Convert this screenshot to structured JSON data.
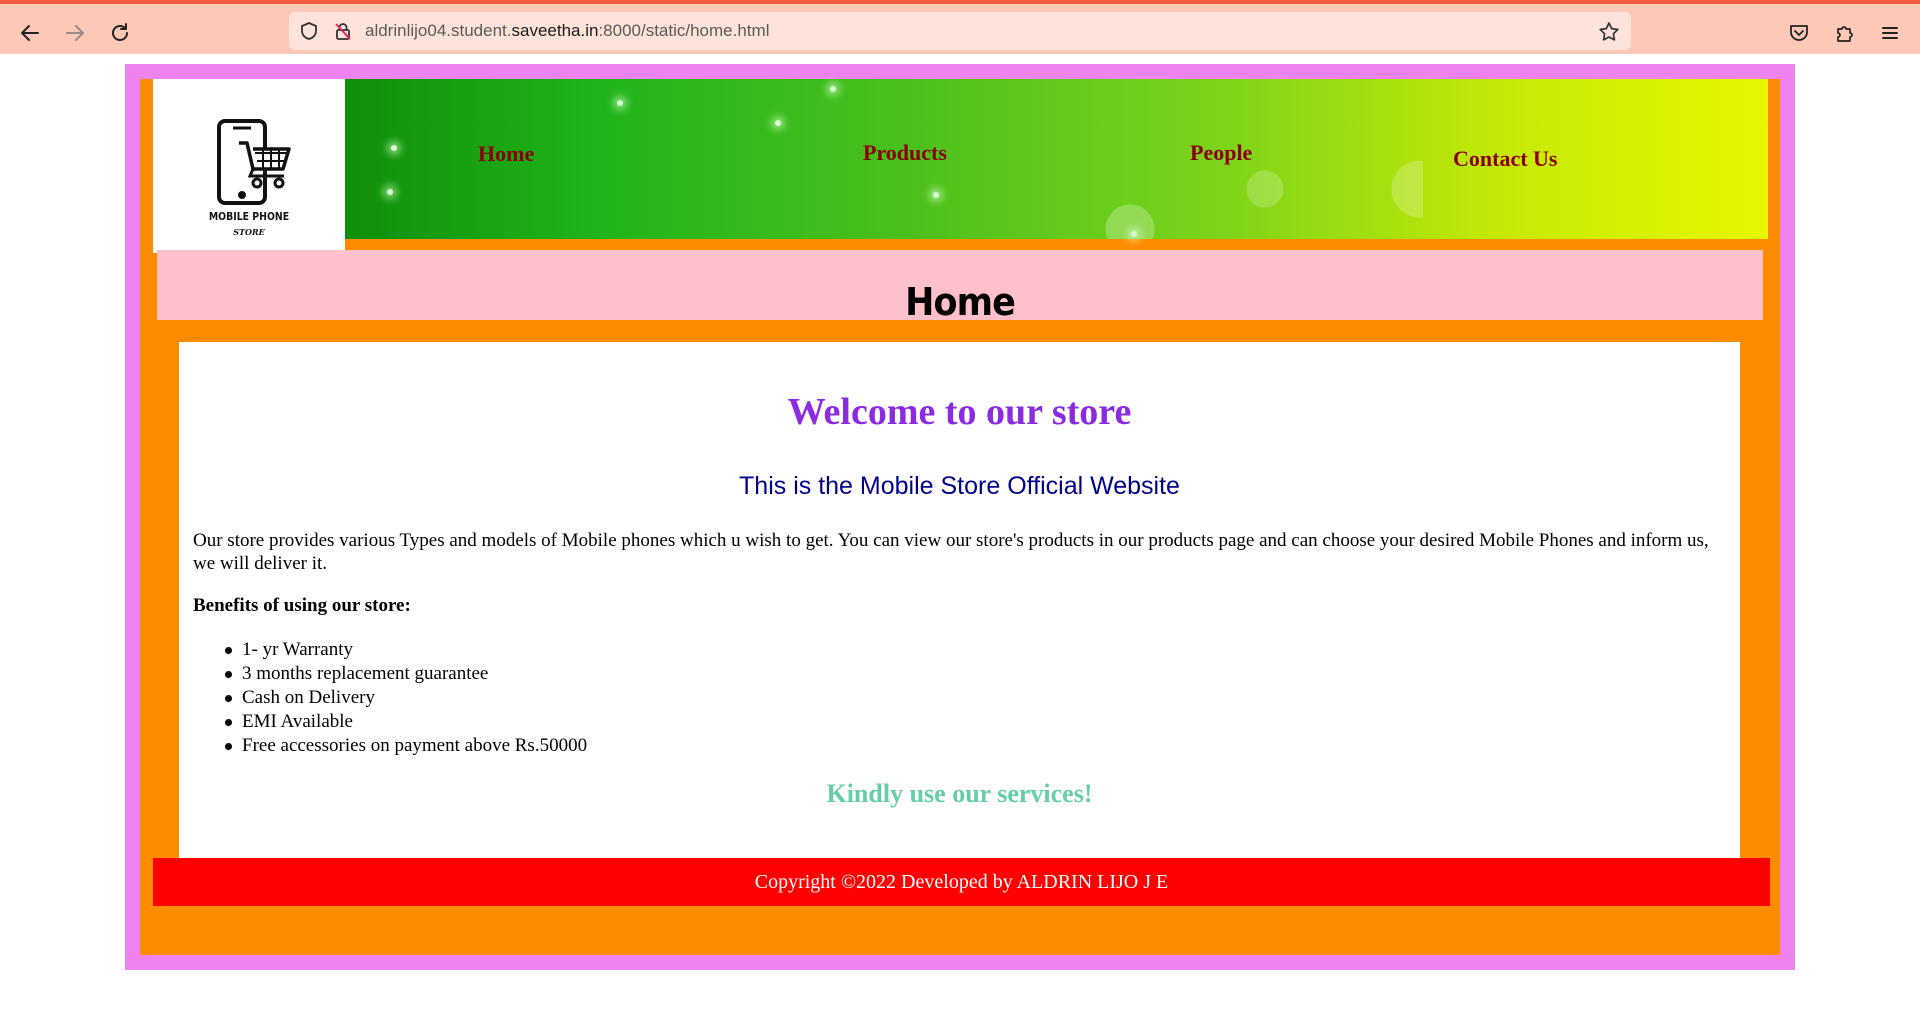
{
  "browser": {
    "url_prefix": "aldrinlijo04.student.",
    "url_domain": "saveetha.in",
    "url_suffix": ":8000/static/home.html"
  },
  "logo": {
    "line1": "MOBILE PHONE",
    "line2": "STORE"
  },
  "nav": {
    "home": "Home",
    "products": "Products",
    "people": "People",
    "contact": "Contact Us"
  },
  "page_title": "Home",
  "content": {
    "welcome": "Welcome to our store",
    "official": "This is the Mobile Store Official Website",
    "description": "Our store provides various Types and models of Mobile phones which u wish to get. You can view our store's products in our products page and can choose your desired Mobile Phones and inform us, we will deliver it.",
    "benefits_heading": "Benefits of using our store:",
    "benefits": [
      "1- yr Warranty",
      "3 months replacement guarantee",
      "Cash on Delivery",
      "EMI Available",
      "Free accessories on payment above Rs.50000"
    ],
    "closing": "Kindly use our services!"
  },
  "footer": "Copyright ©2022 Developed by ALDRIN LIJO J E",
  "colors": {
    "outer_border": "#ee82ee",
    "inner_bg": "#ff8c00",
    "title_bg": "#ffc0cb",
    "nav_text": "#8b0000",
    "welcome": "#8a2be2",
    "official": "#00008b",
    "closing": "#66cdaa",
    "footer_bg": "#ff0000"
  }
}
